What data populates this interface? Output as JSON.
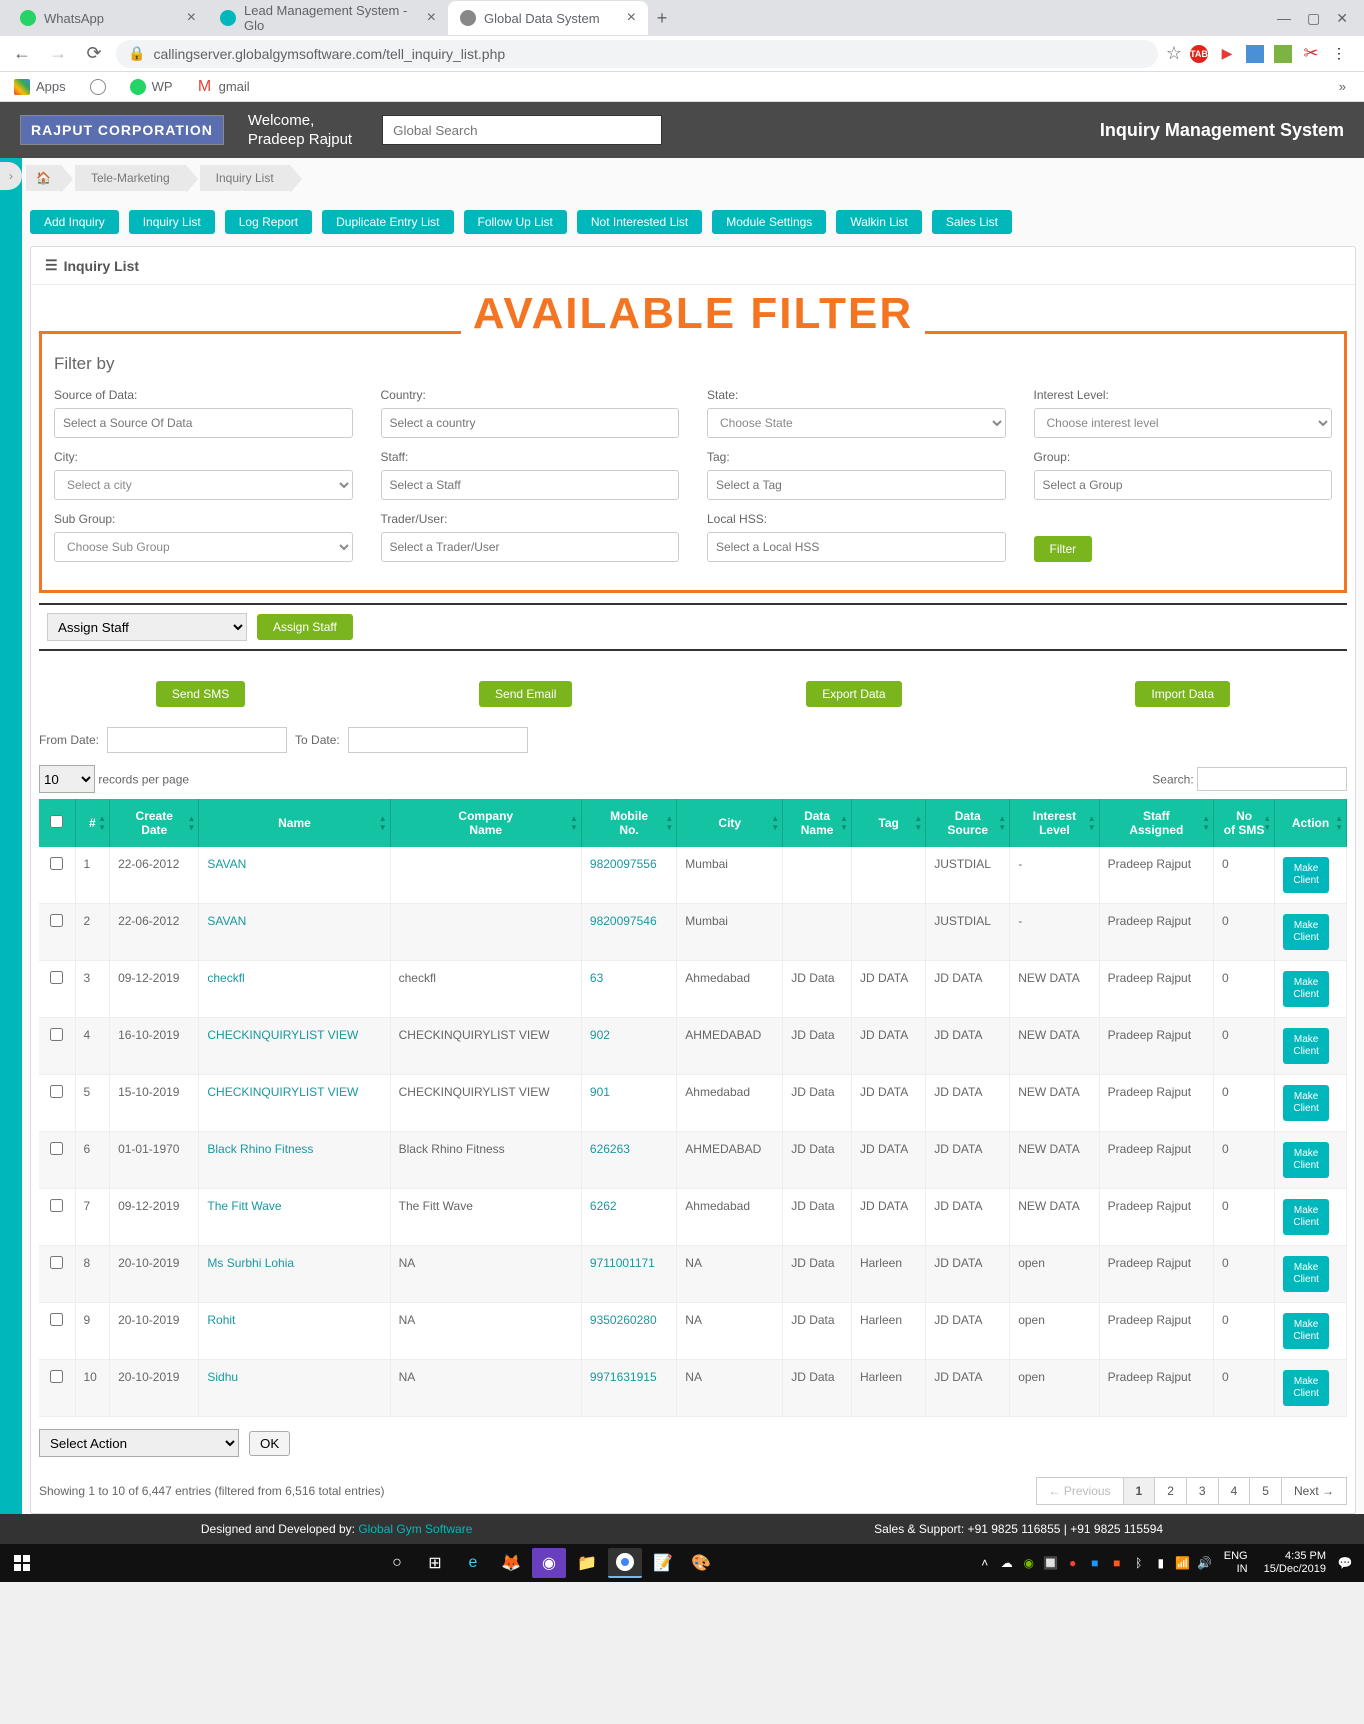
{
  "browser": {
    "tabs": [
      {
        "title": "WhatsApp",
        "favicon": "#25d366"
      },
      {
        "title": "Lead Management System - Glo",
        "favicon": "#00b8bb"
      },
      {
        "title": "Global Data System",
        "favicon": "#666",
        "active": true
      }
    ],
    "url": "callingserver.globalgymsoftware.com/tell_inquiry_list.php",
    "bookmarks": [
      "Apps",
      "",
      "WP",
      "gmail"
    ]
  },
  "header": {
    "corp": "RAJPUT CORPORATION",
    "welcome_line1": "Welcome,",
    "welcome_line2": "Pradeep Rajput",
    "search_placeholder": "Global Search",
    "title": "Inquiry Management System"
  },
  "breadcrumb": {
    "items": [
      "Tele-Marketing",
      "Inquiry List"
    ]
  },
  "actions": [
    "Add Inquiry",
    "Inquiry List",
    "Log Report",
    "Duplicate Entry List",
    "Follow Up List",
    "Not Interested List",
    "Module Settings",
    "Walkin List",
    "Sales List"
  ],
  "panel_title": "Inquiry List",
  "big_label": "AVAILABLE FILTER",
  "filter": {
    "title": "Filter by",
    "fields": {
      "source": {
        "label": "Source of Data:",
        "placeholder": "Select a Source Of Data"
      },
      "country": {
        "label": "Country:",
        "placeholder": "Select a country"
      },
      "state": {
        "label": "State:",
        "placeholder": "Choose State"
      },
      "interest": {
        "label": "Interest Level:",
        "placeholder": "Choose interest level"
      },
      "city": {
        "label": "City:",
        "placeholder": "Select a city"
      },
      "staff": {
        "label": "Staff:",
        "placeholder": "Select a Staff"
      },
      "tag": {
        "label": "Tag:",
        "placeholder": "Select a Tag"
      },
      "group": {
        "label": "Group:",
        "placeholder": "Select a Group"
      },
      "subgroup": {
        "label": "Sub Group:",
        "placeholder": "Choose Sub Group"
      },
      "trader": {
        "label": "Trader/User:",
        "placeholder": "Select a Trader/User"
      },
      "localhss": {
        "label": "Local HSS:",
        "placeholder": "Select a Local HSS"
      }
    },
    "button": "Filter"
  },
  "assign": {
    "select": "Assign Staff",
    "button": "Assign Staff"
  },
  "send": {
    "sms": "Send SMS",
    "email": "Send Email",
    "export": "Export Data",
    "import": "Import Data"
  },
  "dates": {
    "from": "From Date:",
    "to": "To Date:"
  },
  "table_ctrl": {
    "per_page_value": "10",
    "per_page_label": "records per page",
    "search_label": "Search:"
  },
  "columns": [
    "",
    "#",
    "Create Date",
    "Name",
    "Company Name",
    "Mobile No.",
    "City",
    "Data Name",
    "Tag",
    "Data Source",
    "Interest Level",
    "Staff Assigned",
    "No of SMS",
    "Action"
  ],
  "rows": [
    {
      "n": "1",
      "date": "22-06-2012",
      "name": "SAVAN",
      "company": "",
      "mobile": "9820097556",
      "city": "Mumbai",
      "dname": "",
      "tag": "",
      "dsource": "JUSTDIAL",
      "ilevel": "-",
      "staff": "Pradeep Rajput",
      "sms": "0"
    },
    {
      "n": "2",
      "date": "22-06-2012",
      "name": "SAVAN",
      "company": "",
      "mobile": "9820097546",
      "city": "Mumbai",
      "dname": "",
      "tag": "",
      "dsource": "JUSTDIAL",
      "ilevel": "-",
      "staff": "Pradeep Rajput",
      "sms": "0"
    },
    {
      "n": "3",
      "date": "09-12-2019",
      "name": "checkfl",
      "company": "checkfl",
      "mobile": "63",
      "city": "Ahmedabad",
      "dname": "JD Data",
      "tag": "JD DATA",
      "dsource": "JD DATA",
      "ilevel": "NEW DATA",
      "staff": "Pradeep Rajput",
      "sms": "0"
    },
    {
      "n": "4",
      "date": "16-10-2019",
      "name": "CHECKINQUIRYLIST VIEW",
      "company": "CHECKINQUIRYLIST VIEW",
      "mobile": "902",
      "city": "AHMEDABAD",
      "dname": "JD Data",
      "tag": "JD DATA",
      "dsource": "JD DATA",
      "ilevel": "NEW DATA",
      "staff": "Pradeep Rajput",
      "sms": "0"
    },
    {
      "n": "5",
      "date": "15-10-2019",
      "name": "CHECKINQUIRYLIST VIEW",
      "company": "CHECKINQUIRYLIST VIEW",
      "mobile": "901",
      "city": "Ahmedabad",
      "dname": "JD Data",
      "tag": "JD DATA",
      "dsource": "JD DATA",
      "ilevel": "NEW DATA",
      "staff": "Pradeep Rajput",
      "sms": "0"
    },
    {
      "n": "6",
      "date": "01-01-1970",
      "name": "Black Rhino Fitness",
      "company": "Black Rhino Fitness",
      "mobile": "626263",
      "city": "AHMEDABAD",
      "dname": "JD Data",
      "tag": "JD DATA",
      "dsource": "JD DATA",
      "ilevel": "NEW DATA",
      "staff": "Pradeep Rajput",
      "sms": "0"
    },
    {
      "n": "7",
      "date": "09-12-2019",
      "name": "The Fitt Wave",
      "company": "The Fitt Wave",
      "mobile": "6262",
      "city": "Ahmedabad",
      "dname": "JD Data",
      "tag": "JD DATA",
      "dsource": "JD DATA",
      "ilevel": "NEW DATA",
      "staff": "Pradeep Rajput",
      "sms": "0"
    },
    {
      "n": "8",
      "date": "20-10-2019",
      "name": "Ms Surbhi Lohia",
      "company": "NA",
      "mobile": "9711001171",
      "city": "NA",
      "dname": "JD Data",
      "tag": "Harleen",
      "dsource": "JD DATA",
      "ilevel": "open",
      "staff": "Pradeep Rajput",
      "sms": "0"
    },
    {
      "n": "9",
      "date": "20-10-2019",
      "name": "Rohit",
      "company": "NA",
      "mobile": "9350260280",
      "city": "NA",
      "dname": "JD Data",
      "tag": "Harleen",
      "dsource": "JD DATA",
      "ilevel": "open",
      "staff": "Pradeep Rajput",
      "sms": "0"
    },
    {
      "n": "10",
      "date": "20-10-2019",
      "name": "Sidhu",
      "company": "NA",
      "mobile": "9971631915",
      "city": "NA",
      "dname": "JD Data",
      "tag": "Harleen",
      "dsource": "JD DATA",
      "ilevel": "open",
      "staff": "Pradeep Rajput",
      "sms": "0"
    }
  ],
  "row_action": "Make Client",
  "footer_action": {
    "select": "Select Action",
    "ok": "OK"
  },
  "info_text": "Showing 1 to 10 of 6,447 entries (filtered from 6,516 total entries)",
  "pagination": {
    "prev": "← Previous",
    "pages": [
      "1",
      "2",
      "3",
      "4",
      "5"
    ],
    "next": "Next →"
  },
  "footer": {
    "designed": "Designed and Developed by:",
    "link": "Global Gym Software",
    "support": "Sales & Support: +91 9825 116855 | +91 9825 115594"
  },
  "clock": {
    "lang": "ENG",
    "region": "IN",
    "time": "4:35 PM",
    "date": "15/Dec/2019"
  }
}
